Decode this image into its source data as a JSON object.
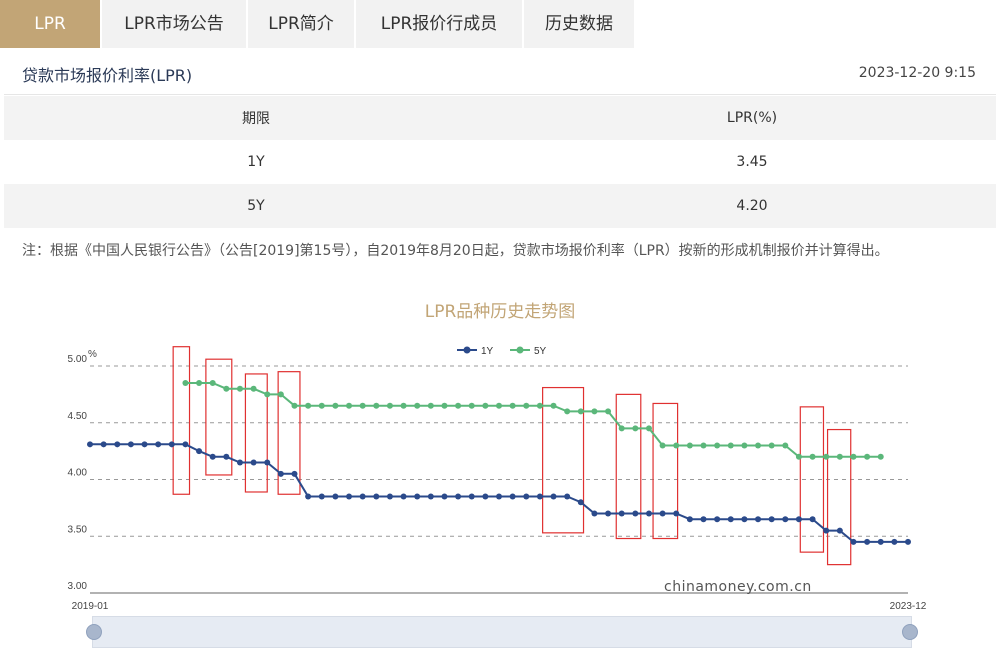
{
  "tabs": [
    {
      "label": "LPR",
      "active": true
    },
    {
      "label": "LPR市场公告"
    },
    {
      "label": "LPR简介"
    },
    {
      "label": "LPR报价行成员"
    },
    {
      "label": "历史数据"
    }
  ],
  "header": {
    "title": "贷款市场报价利率(LPR)",
    "timestamp": "2023-12-20 9:15"
  },
  "table": {
    "headers": [
      "期限",
      "LPR(%)"
    ],
    "rows": [
      [
        "1Y",
        "3.45"
      ],
      [
        "5Y",
        "4.20"
      ]
    ]
  },
  "note": "注：根据《中国人民银行公告》（公告[2019]第15号），自2019年8月20日起，贷款市场报价利率（LPR）按新的形成机制报价并计算得出。",
  "chart_data": {
    "type": "line",
    "title": "LPR品种历史走势图",
    "ylabel": "%",
    "ylim": [
      3.0,
      5.0
    ],
    "yticks": [
      "5.00",
      "4.50",
      "4.00",
      "3.50",
      "3.00"
    ],
    "x_start_label": "2019-01",
    "x_end_label": "2023-12",
    "legend_position": "top-center",
    "grid": true,
    "watermark": "chinamoney.com.cn",
    "colors": {
      "1Y": "#2b4a8b",
      "5Y": "#5bb77a",
      "highlight": "#e03030"
    },
    "series": [
      {
        "name": "1Y",
        "values": [
          4.31,
          4.31,
          4.31,
          4.31,
          4.31,
          4.31,
          4.31,
          4.31,
          4.25,
          4.2,
          4.2,
          4.15,
          4.15,
          4.15,
          4.05,
          4.05,
          3.85,
          3.85,
          3.85,
          3.85,
          3.85,
          3.85,
          3.85,
          3.85,
          3.85,
          3.85,
          3.85,
          3.85,
          3.85,
          3.85,
          3.85,
          3.85,
          3.85,
          3.85,
          3.85,
          3.85,
          3.8,
          3.7,
          3.7,
          3.7,
          3.7,
          3.7,
          3.7,
          3.7,
          3.65,
          3.65,
          3.65,
          3.65,
          3.65,
          3.65,
          3.65,
          3.65,
          3.65,
          3.65,
          3.55,
          3.55,
          3.45,
          3.45,
          3.45,
          3.45,
          3.45
        ]
      },
      {
        "name": "5Y",
        "values": [
          null,
          null,
          null,
          null,
          null,
          null,
          null,
          4.85,
          4.85,
          4.85,
          4.8,
          4.8,
          4.8,
          4.75,
          4.75,
          4.65,
          4.65,
          4.65,
          4.65,
          4.65,
          4.65,
          4.65,
          4.65,
          4.65,
          4.65,
          4.65,
          4.65,
          4.65,
          4.65,
          4.65,
          4.65,
          4.65,
          4.65,
          4.65,
          4.65,
          4.6,
          4.6,
          4.6,
          4.6,
          4.45,
          4.45,
          4.45,
          4.3,
          4.3,
          4.3,
          4.3,
          4.3,
          4.3,
          4.3,
          4.3,
          4.3,
          4.3,
          4.2,
          4.2,
          4.2,
          4.2,
          4.2,
          4.2,
          4.2
        ]
      }
    ]
  }
}
